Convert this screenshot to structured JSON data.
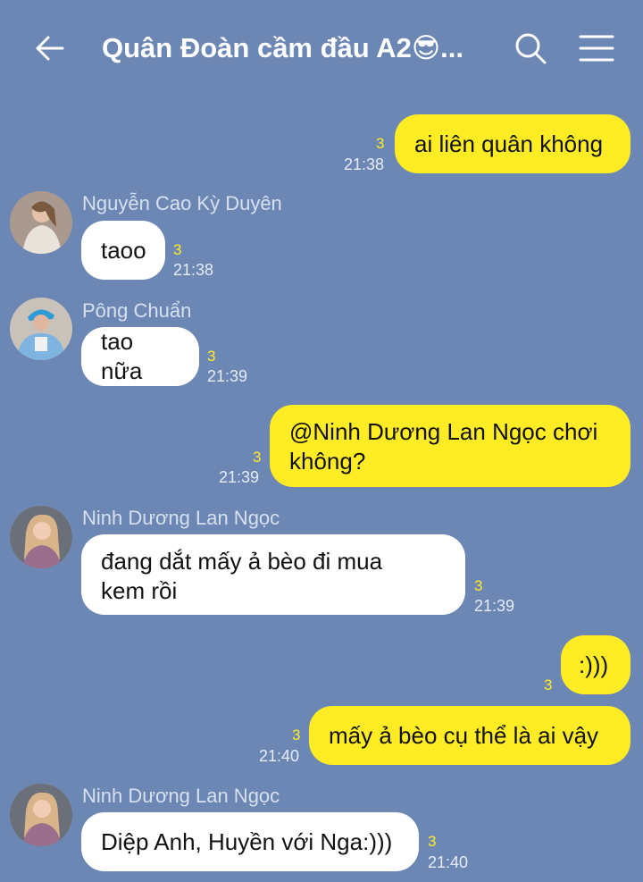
{
  "header": {
    "title": "Quân Đoàn cầm đầu A2😎..."
  },
  "messages": [
    {
      "type": "out",
      "text": "ai liên quân không",
      "read": "3",
      "time": "21:38"
    },
    {
      "type": "in",
      "sender": "Nguyễn Cao Kỳ Duyên",
      "text": "taoo",
      "read": "3",
      "time": "21:38"
    },
    {
      "type": "in",
      "sender": "Pông Chuẩn",
      "text": "tao nữa",
      "read": "3",
      "time": "21:39"
    },
    {
      "type": "out",
      "text_line1": "@Ninh Dương Lan Ngọc chơi",
      "text_line2": "không?",
      "read": "3",
      "time": "21:39"
    },
    {
      "type": "in",
      "sender": "Ninh Dương Lan Ngọc",
      "text_line1": "đang dắt mấy ả bèo đi mua",
      "text_line2": "kem rồi",
      "read": "3",
      "time": "21:39"
    },
    {
      "type": "out",
      "text": ":)))",
      "read": "3"
    },
    {
      "type": "out",
      "text": "mấy ả bèo cụ thể là ai vậy",
      "read": "3",
      "time": "21:40"
    },
    {
      "type": "in",
      "sender": "Ninh Dương Lan Ngọc",
      "text": "Diệp Anh, Huyền với Nga:)))",
      "read": "3",
      "time": "21:40"
    }
  ],
  "icons": [
    "back-arrow-icon",
    "search-icon",
    "menu-icon"
  ],
  "colors": {
    "background": "#6c87b4",
    "outgoing_bubble": "#ffec25",
    "incoming_bubble": "#ffffff",
    "read_count": "#ffec25"
  }
}
